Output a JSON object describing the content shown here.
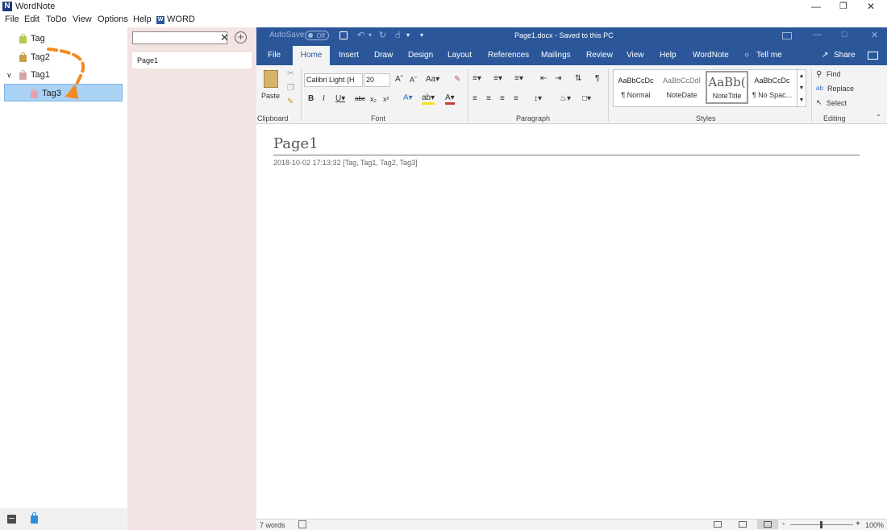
{
  "app": {
    "logo": "N",
    "title": "WordNote"
  },
  "menu": [
    "File",
    "Edit",
    "ToDo",
    "View",
    "Options",
    "Help",
    "WORD"
  ],
  "tags": {
    "items": [
      {
        "label": "Tag",
        "color": "#b6c94b",
        "icon": "tag-icon-green"
      },
      {
        "label": "Tag2",
        "color": "#c8a24a",
        "icon": "tag-icon-gold"
      },
      {
        "label": "Tag1",
        "color": "#d6a3a8",
        "icon": "tag-icon-pink",
        "expanded": true
      },
      {
        "label": "Tag3",
        "color": "#e8a1ac",
        "icon": "tag-icon-pink",
        "selected": true
      }
    ],
    "bottom_icons": [
      "notebook-icon",
      "tag-icon-blue"
    ]
  },
  "pages": {
    "search_placeholder": "",
    "items": [
      "Page1"
    ]
  },
  "word": {
    "autosave_label": "AutoSave",
    "autosave_state": "Off",
    "doc_title": "Page1.docx  -  Saved to this PC",
    "tabs": [
      "File",
      "Home",
      "Insert",
      "Draw",
      "Design",
      "Layout",
      "References",
      "Mailings",
      "Review",
      "View",
      "Help",
      "WordNote",
      "Tell me",
      "Share"
    ],
    "active_tab": "Home",
    "ribbon": {
      "paste_label": "Paste",
      "font_name": "Calibri Light (H",
      "font_size": "20",
      "styles": [
        {
          "sample": "AaBbCcDc",
          "name": "¶ Normal"
        },
        {
          "sample": "AaBbCcDdI",
          "name": "NoteDate"
        },
        {
          "sample": "AaBb(",
          "name": "NoteTitle"
        },
        {
          "sample": "AaBbCcDc",
          "name": "¶ No Spac..."
        }
      ],
      "editing": {
        "find": "Find",
        "replace": "Replace",
        "select": "Select"
      },
      "groups": [
        "Clipboard",
        "Font",
        "Paragraph",
        "Styles",
        "Editing"
      ]
    },
    "document": {
      "title": "Page1",
      "meta": "2018-10-02 17:13:32  [Tag, Tag1, Tag2, Tag3]"
    },
    "status": {
      "word_count": "7 words",
      "zoom": "100%"
    }
  }
}
